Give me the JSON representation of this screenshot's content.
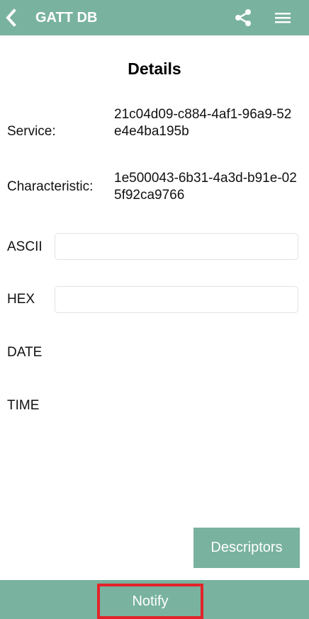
{
  "appbar": {
    "title": "GATT DB",
    "icons": {
      "back": "chevron-left-icon",
      "share": "share-icon",
      "menu": "hamburger-menu-icon"
    },
    "color": "#79b29f"
  },
  "details": {
    "title": "Details",
    "service_label": "Service:",
    "service_value": "21c04d09-c884-4af1-96a9-52e4e4ba195b",
    "characteristic_label": "Characteristic:",
    "characteristic_value": "1e500043-6b31-4a3d-b91e-025f92ca9766"
  },
  "fields": {
    "ascii_label": "ASCII",
    "ascii_value": "",
    "hex_label": "HEX",
    "hex_value": "",
    "date_label": "DATE",
    "time_label": "TIME"
  },
  "buttons": {
    "descriptors": "Descriptors",
    "notify": "Notify"
  },
  "colors": {
    "accent": "#79b29f",
    "highlight": "#e2232a"
  }
}
